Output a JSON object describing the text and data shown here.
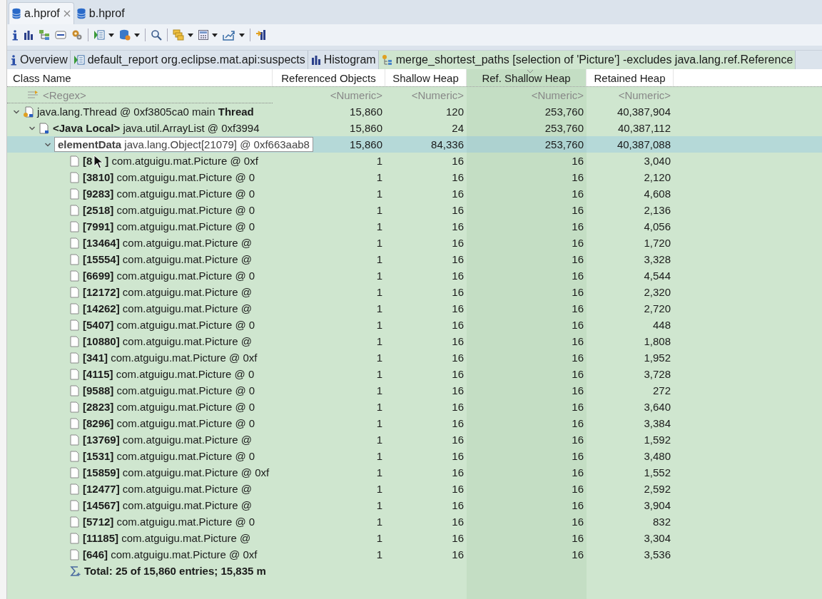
{
  "editor_tabs": [
    {
      "label": "a.hprof",
      "selected": true,
      "closable": true
    },
    {
      "label": "b.hprof",
      "selected": false,
      "closable": false
    }
  ],
  "toolbar": [
    {
      "kind": "info",
      "dropdown": false
    },
    {
      "kind": "histogram",
      "dropdown": false
    },
    {
      "kind": "tree",
      "dropdown": false
    },
    {
      "kind": "oql",
      "dropdown": false
    },
    {
      "kind": "gear",
      "dropdown": false
    },
    {
      "kind": "sep"
    },
    {
      "kind": "report",
      "dropdown": true
    },
    {
      "kind": "dbgear",
      "dropdown": true
    },
    {
      "kind": "sep"
    },
    {
      "kind": "search",
      "dropdown": false
    },
    {
      "kind": "sep"
    },
    {
      "kind": "group",
      "dropdown": true
    },
    {
      "kind": "calc",
      "dropdown": true
    },
    {
      "kind": "export",
      "dropdown": true
    },
    {
      "kind": "sep"
    },
    {
      "kind": "compare",
      "dropdown": false
    }
  ],
  "result_tabs": [
    {
      "kind": "info",
      "label": "Overview",
      "selected": false
    },
    {
      "kind": "report",
      "label": "default_report  org.eclipse.mat.api:suspects",
      "selected": false
    },
    {
      "kind": "histogram",
      "label": "Histogram",
      "selected": false
    },
    {
      "kind": "paths",
      "label": "merge_shortest_paths  [selection of 'Picture'] -excludes java.lang.ref.Reference",
      "selected": true
    }
  ],
  "table": {
    "columns": [
      {
        "label": "Class Name",
        "sorted": false
      },
      {
        "label": "Referenced Objects",
        "sorted": false
      },
      {
        "label": "Shallow Heap",
        "sorted": false
      },
      {
        "label": "Ref. Shallow Heap",
        "sorted": true
      },
      {
        "label": "Retained Heap",
        "sorted": false
      }
    ],
    "filters": [
      "<Regex>",
      "<Numeric>",
      "<Numeric>",
      "<Numeric>",
      "<Numeric>"
    ],
    "rows": [
      {
        "kind": "thread",
        "label": "java.lang.Thread @ 0xf3805ca0  main **Thread**",
        "expanded": true,
        "selected": false,
        "values": [
          "15,860",
          "120",
          "253,760",
          "40,387,904"
        ],
        "children": [
          {
            "kind": "local",
            "label": "**<Java Local>** java.util.ArrayList @ 0xf3994",
            "expanded": true,
            "selected": false,
            "values": [
              "15,860",
              "24",
              "253,760",
              "40,387,112"
            ],
            "children": [
              {
                "kind": "array",
                "tooltip": "**elementData** java.lang.Object[21079] @ 0xf663aab8",
                "expanded": true,
                "selected": true,
                "values": [
                  "15,860",
                  "84,336",
                  "253,760",
                  "40,387,088"
                ],
                "children": [
                  {
                    "kind": "object",
                    "label": "**[8**",
                    "label_after": "**]** com.atguigu.mat.Picture @ 0xf",
                    "selected": false,
                    "values": [
                      "1",
                      "16",
                      "16",
                      "3,040"
                    ]
                  },
                  {
                    "kind": "object",
                    "label": "**[3810]** com.atguigu.mat.Picture @ 0",
                    "selected": false,
                    "values": [
                      "1",
                      "16",
                      "16",
                      "2,120"
                    ]
                  },
                  {
                    "kind": "object",
                    "label": "**[9283]** com.atguigu.mat.Picture @ 0",
                    "selected": false,
                    "values": [
                      "1",
                      "16",
                      "16",
                      "4,608"
                    ]
                  },
                  {
                    "kind": "object",
                    "label": "**[2518]** com.atguigu.mat.Picture @ 0",
                    "selected": false,
                    "values": [
                      "1",
                      "16",
                      "16",
                      "2,136"
                    ]
                  },
                  {
                    "kind": "object",
                    "label": "**[7991]** com.atguigu.mat.Picture @ 0",
                    "selected": false,
                    "values": [
                      "1",
                      "16",
                      "16",
                      "4,056"
                    ]
                  },
                  {
                    "kind": "object",
                    "label": "**[13464]** com.atguigu.mat.Picture @",
                    "selected": false,
                    "values": [
                      "1",
                      "16",
                      "16",
                      "1,720"
                    ]
                  },
                  {
                    "kind": "object",
                    "label": "**[15554]** com.atguigu.mat.Picture @",
                    "selected": false,
                    "values": [
                      "1",
                      "16",
                      "16",
                      "3,328"
                    ]
                  },
                  {
                    "kind": "object",
                    "label": "**[6699]** com.atguigu.mat.Picture @ 0",
                    "selected": false,
                    "values": [
                      "1",
                      "16",
                      "16",
                      "4,544"
                    ]
                  },
                  {
                    "kind": "object",
                    "label": "**[12172]** com.atguigu.mat.Picture @",
                    "selected": false,
                    "values": [
                      "1",
                      "16",
                      "16",
                      "2,320"
                    ]
                  },
                  {
                    "kind": "object",
                    "label": "**[14262]** com.atguigu.mat.Picture @",
                    "selected": false,
                    "values": [
                      "1",
                      "16",
                      "16",
                      "2,720"
                    ]
                  },
                  {
                    "kind": "object",
                    "label": "**[5407]** com.atguigu.mat.Picture @ 0",
                    "selected": false,
                    "values": [
                      "1",
                      "16",
                      "16",
                      "448"
                    ]
                  },
                  {
                    "kind": "object",
                    "label": "**[10880]** com.atguigu.mat.Picture @",
                    "selected": false,
                    "values": [
                      "1",
                      "16",
                      "16",
                      "1,808"
                    ]
                  },
                  {
                    "kind": "object",
                    "label": "**[341]** com.atguigu.mat.Picture @ 0xf",
                    "selected": false,
                    "values": [
                      "1",
                      "16",
                      "16",
                      "1,952"
                    ]
                  },
                  {
                    "kind": "object",
                    "label": "**[4115]** com.atguigu.mat.Picture @ 0",
                    "selected": false,
                    "values": [
                      "1",
                      "16",
                      "16",
                      "3,728"
                    ]
                  },
                  {
                    "kind": "object",
                    "label": "**[9588]** com.atguigu.mat.Picture @ 0",
                    "selected": false,
                    "values": [
                      "1",
                      "16",
                      "16",
                      "272"
                    ]
                  },
                  {
                    "kind": "object",
                    "label": "**[2823]** com.atguigu.mat.Picture @ 0",
                    "selected": false,
                    "values": [
                      "1",
                      "16",
                      "16",
                      "3,640"
                    ]
                  },
                  {
                    "kind": "object",
                    "label": "**[8296]** com.atguigu.mat.Picture @ 0",
                    "selected": false,
                    "values": [
                      "1",
                      "16",
                      "16",
                      "3,384"
                    ]
                  },
                  {
                    "kind": "object",
                    "label": "**[13769]** com.atguigu.mat.Picture @",
                    "selected": false,
                    "values": [
                      "1",
                      "16",
                      "16",
                      "1,592"
                    ]
                  },
                  {
                    "kind": "object",
                    "label": "**[1531]** com.atguigu.mat.Picture @ 0",
                    "selected": false,
                    "values": [
                      "1",
                      "16",
                      "16",
                      "3,480"
                    ]
                  },
                  {
                    "kind": "object",
                    "label": "**[15859]** com.atguigu.mat.Picture @ 0xf",
                    "selected": false,
                    "values": [
                      "1",
                      "16",
                      "16",
                      "1,552"
                    ]
                  },
                  {
                    "kind": "object",
                    "label": "**[12477]** com.atguigu.mat.Picture @",
                    "selected": false,
                    "values": [
                      "1",
                      "16",
                      "16",
                      "2,592"
                    ]
                  },
                  {
                    "kind": "object",
                    "label": "**[14567]** com.atguigu.mat.Picture @",
                    "selected": false,
                    "values": [
                      "1",
                      "16",
                      "16",
                      "3,904"
                    ]
                  },
                  {
                    "kind": "object",
                    "label": "**[5712]** com.atguigu.mat.Picture @ 0",
                    "selected": false,
                    "values": [
                      "1",
                      "16",
                      "16",
                      "832"
                    ]
                  },
                  {
                    "kind": "object",
                    "label": "**[11185]** com.atguigu.mat.Picture @",
                    "selected": false,
                    "values": [
                      "1",
                      "16",
                      "16",
                      "3,304"
                    ]
                  },
                  {
                    "kind": "object",
                    "label": "**[646]** com.atguigu.mat.Picture @ 0xf",
                    "selected": false,
                    "values": [
                      "1",
                      "16",
                      "16",
                      "3,536"
                    ]
                  },
                  {
                    "kind": "total",
                    "label": "Total: 25 of 15,860 entries; 15,835 m",
                    "selected": false
                  }
                ]
              }
            ]
          }
        ]
      }
    ]
  }
}
